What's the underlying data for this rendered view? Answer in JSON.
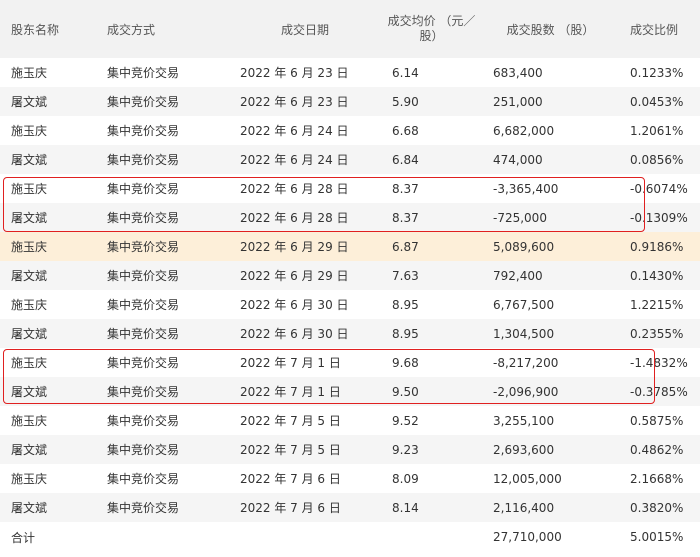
{
  "headers": [
    "股东名称",
    "成交方式",
    "成交日期",
    "成交均价 （元／股）",
    "成交股数 （股）",
    "成交比例"
  ],
  "rows": [
    [
      "施玉庆",
      "集中竞价交易",
      "2022 年 6 月 23 日",
      "6.14",
      "683,400",
      "0.1233%"
    ],
    [
      "屠文斌",
      "集中竞价交易",
      "2022 年 6 月 23 日",
      "5.90",
      "251,000",
      "0.0453%"
    ],
    [
      "施玉庆",
      "集中竞价交易",
      "2022 年 6 月 24 日",
      "6.68",
      "6,682,000",
      "1.2061%"
    ],
    [
      "屠文斌",
      "集中竞价交易",
      "2022 年 6 月 24 日",
      "6.84",
      "474,000",
      "0.0856%"
    ],
    [
      "施玉庆",
      "集中竞价交易",
      "2022 年 6 月 28 日",
      "8.37",
      "-3,365,400",
      "-0.6074%"
    ],
    [
      "屠文斌",
      "集中竞价交易",
      "2022 年 6 月 28 日",
      "8.37",
      "-725,000",
      "-0.1309%"
    ],
    [
      "施玉庆",
      "集中竞价交易",
      "2022 年 6 月 29 日",
      "6.87",
      "5,089,600",
      "0.9186%"
    ],
    [
      "屠文斌",
      "集中竞价交易",
      "2022 年 6 月 29 日",
      "7.63",
      "792,400",
      "0.1430%"
    ],
    [
      "施玉庆",
      "集中竞价交易",
      "2022 年 6 月 30 日",
      "8.95",
      "6,767,500",
      "1.2215%"
    ],
    [
      "屠文斌",
      "集中竞价交易",
      "2022 年 6 月 30 日",
      "8.95",
      "1,304,500",
      "0.2355%"
    ],
    [
      "施玉庆",
      "集中竞价交易",
      "2022 年 7 月 1 日",
      "9.68",
      "-8,217,200",
      "-1.4832%"
    ],
    [
      "屠文斌",
      "集中竞价交易",
      "2022 年 7 月 1 日",
      "9.50",
      "-2,096,900",
      "-0.3785%"
    ],
    [
      "施玉庆",
      "集中竞价交易",
      "2022 年 7 月 5 日",
      "9.52",
      "3,255,100",
      "0.5875%"
    ],
    [
      "屠文斌",
      "集中竞价交易",
      "2022 年 7 月 5 日",
      "9.23",
      "2,693,600",
      "0.4862%"
    ],
    [
      "施玉庆",
      "集中竞价交易",
      "2022 年 7 月 6 日",
      "8.09",
      "12,005,000",
      "2.1668%"
    ],
    [
      "屠文斌",
      "集中竞价交易",
      "2022 年 7 月 6 日",
      "8.14",
      "2,116,400",
      "0.3820%"
    ]
  ],
  "total": [
    "合计",
    "",
    "",
    "",
    "27,710,000",
    "5.0015%"
  ],
  "colors": {
    "highlight_row": "#fdefd9",
    "annotation_box": "#e02020"
  }
}
